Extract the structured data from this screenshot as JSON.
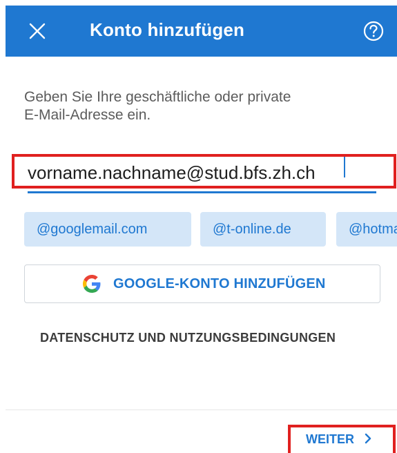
{
  "header": {
    "title": "Konto hinzufügen",
    "close_icon": "close-icon",
    "help_icon": "help-circle-icon",
    "color": "#1f78d1"
  },
  "prompt": {
    "line1": "Geben Sie Ihre geschäftliche oder private",
    "line2": "E-Mail-Adresse ein."
  },
  "email": {
    "value": "vorname.nachname@stud.bfs.zh.ch",
    "placeholder": ""
  },
  "suggestions": [
    "@googlemail.com",
    "@t-online.de",
    "@hotmail.com"
  ],
  "google_button": {
    "label": "GOOGLE-KONTO HINZUFÜGEN",
    "icon": "google-g-icon"
  },
  "privacy_link": "DATENSCHUTZ UND NUTZUNGSBEDINGUNGEN",
  "next_button": {
    "label": "WEITER",
    "icon": "chevron-right-icon"
  },
  "highlight_color": "#e0201f"
}
